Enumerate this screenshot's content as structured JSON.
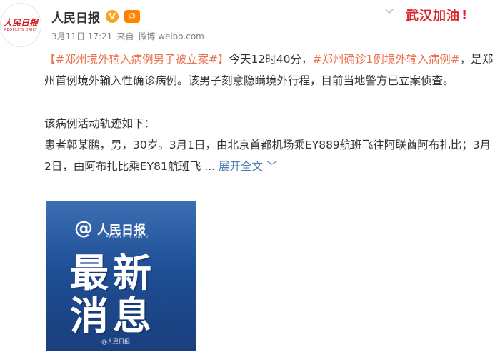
{
  "header": {
    "avatar_logo": "人民日报",
    "avatar_sub": "PEOPLE'S DAILY",
    "username": "人民日报",
    "verified_glyph": "V",
    "member_glyph": "☺",
    "date": "3月11日 17:21",
    "source_prefix": "来自",
    "source": "微博 weibo.com",
    "badge_text": "武汉加油",
    "badge_bang": "!"
  },
  "post": {
    "tag1": "【#郑州境外输入病例男子被立案#】",
    "text1": "今天12时40分，",
    "tag2": "#郑州确诊1例境外输入病例#",
    "text2": "，是郑州首例境外输入性确诊病例。该男子刻意隐瞒境外行程，目前当地警方已立案侦查。",
    "para2_line1": "该病例活动轨迹如下：",
    "para2_line2": "患者郭某鹏，男，30岁。3月1日，由北京首都机场乘EY889航班飞往阿联酋阿布扎比；3月2日，由阿布扎比乘EY81航班飞",
    "ellipsis": " ... ",
    "expand_label": "展开全文",
    "expand_icon": "﹀"
  },
  "image": {
    "at_glyph": "@",
    "logo_text": "人民日报",
    "logo_sub": "PEOPLE'S DAILY",
    "headline_line1": "最新",
    "headline_line2": "消息",
    "watermark": "@人民日报"
  }
}
